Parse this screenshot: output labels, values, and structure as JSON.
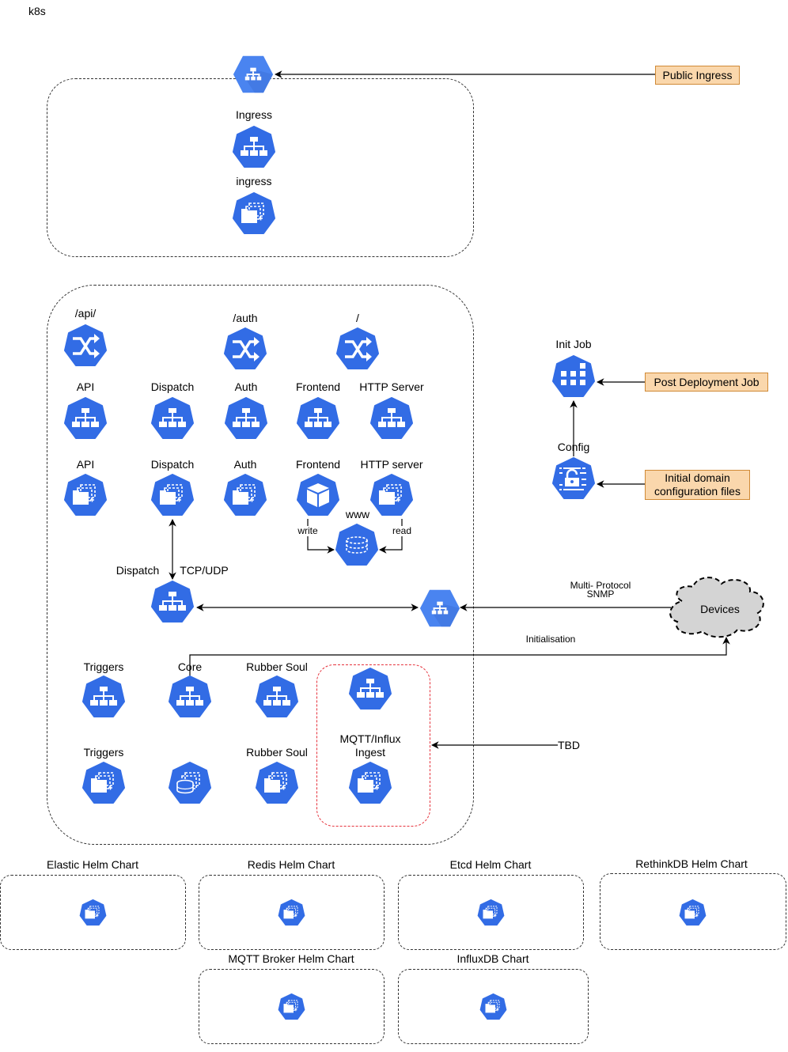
{
  "title": "k8s",
  "colors": {
    "k8s_blue": "#326ce5",
    "gcp_blue": "#4a84f0",
    "note_fill": "#fad7ac",
    "note_border": "#d08a36",
    "red_group": "#e6323c",
    "cloud_fill": "#d4d4d4"
  },
  "top": {
    "gcp_lb_icon": "gcp-load-balancer-icon",
    "service_label": "Ingress",
    "deploy_label": "ingress"
  },
  "public_ingress": "Public Ingress",
  "routes": [
    "/api/",
    "/auth",
    "/"
  ],
  "services": [
    "API",
    "Dispatch",
    "Auth",
    "Frontend",
    "HTTP Server"
  ],
  "deployments": [
    "API",
    "Dispatch",
    "Auth",
    "Frontend",
    "HTTP server"
  ],
  "www": {
    "label": "www",
    "write": "write",
    "read": "read"
  },
  "dispatch_lb": {
    "label": "Dispatch",
    "protocol": "TCP/UDP"
  },
  "devices": {
    "label": "Devices",
    "link_label": "Multi- Protocol\nSNMP",
    "link_line1": "Multi- Protocol",
    "link_line2": "SNMP",
    "init_label": "Initialisation"
  },
  "init": {
    "job_label": "Init Job",
    "config_label": "Config",
    "post_deploy_note": "Post Deployment Job",
    "config_note_line1": "Initial domain",
    "config_note_line2": "configuration files"
  },
  "bottom_services": [
    "Triggers",
    "Core",
    "Rubber Soul"
  ],
  "bottom_deployments": [
    "Triggers",
    "",
    "Rubber Soul"
  ],
  "ingest": {
    "label_line1": "MQTT/Influx",
    "label_line2": "Ingest",
    "tbd": "TBD"
  },
  "helm_charts": [
    "Elastic Helm Chart",
    "Redis Helm Chart",
    "Etcd Helm Chart",
    "RethinkDB Helm Chart",
    "MQTT Broker Helm Chart",
    "InfluxDB Chart"
  ]
}
